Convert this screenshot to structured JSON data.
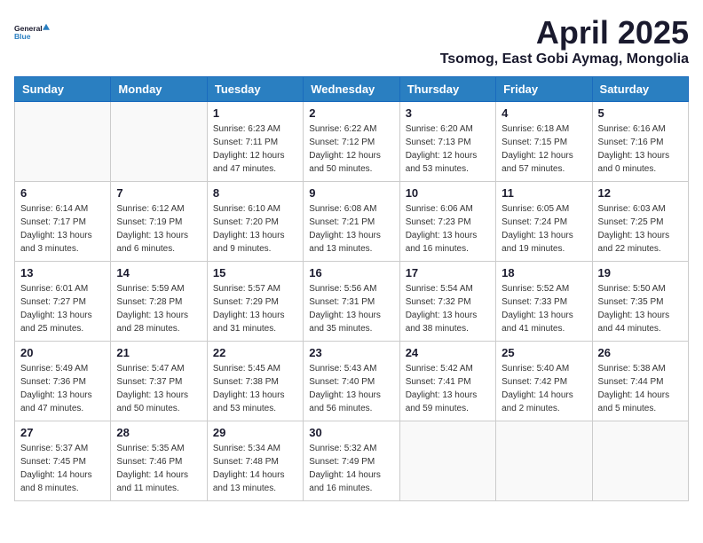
{
  "logo": {
    "text_general": "General",
    "text_blue": "Blue"
  },
  "title": "April 2025",
  "location": "Tsomog, East Gobi Aymag, Mongolia",
  "weekdays": [
    "Sunday",
    "Monday",
    "Tuesday",
    "Wednesday",
    "Thursday",
    "Friday",
    "Saturday"
  ],
  "weeks": [
    [
      {
        "day": null
      },
      {
        "day": null
      },
      {
        "day": "1",
        "sunrise": "6:23 AM",
        "sunset": "7:11 PM",
        "daylight": "12 hours and 47 minutes."
      },
      {
        "day": "2",
        "sunrise": "6:22 AM",
        "sunset": "7:12 PM",
        "daylight": "12 hours and 50 minutes."
      },
      {
        "day": "3",
        "sunrise": "6:20 AM",
        "sunset": "7:13 PM",
        "daylight": "12 hours and 53 minutes."
      },
      {
        "day": "4",
        "sunrise": "6:18 AM",
        "sunset": "7:15 PM",
        "daylight": "12 hours and 57 minutes."
      },
      {
        "day": "5",
        "sunrise": "6:16 AM",
        "sunset": "7:16 PM",
        "daylight": "13 hours and 0 minutes."
      }
    ],
    [
      {
        "day": "6",
        "sunrise": "6:14 AM",
        "sunset": "7:17 PM",
        "daylight": "13 hours and 3 minutes."
      },
      {
        "day": "7",
        "sunrise": "6:12 AM",
        "sunset": "7:19 PM",
        "daylight": "13 hours and 6 minutes."
      },
      {
        "day": "8",
        "sunrise": "6:10 AM",
        "sunset": "7:20 PM",
        "daylight": "13 hours and 9 minutes."
      },
      {
        "day": "9",
        "sunrise": "6:08 AM",
        "sunset": "7:21 PM",
        "daylight": "13 hours and 13 minutes."
      },
      {
        "day": "10",
        "sunrise": "6:06 AM",
        "sunset": "7:23 PM",
        "daylight": "13 hours and 16 minutes."
      },
      {
        "day": "11",
        "sunrise": "6:05 AM",
        "sunset": "7:24 PM",
        "daylight": "13 hours and 19 minutes."
      },
      {
        "day": "12",
        "sunrise": "6:03 AM",
        "sunset": "7:25 PM",
        "daylight": "13 hours and 22 minutes."
      }
    ],
    [
      {
        "day": "13",
        "sunrise": "6:01 AM",
        "sunset": "7:27 PM",
        "daylight": "13 hours and 25 minutes."
      },
      {
        "day": "14",
        "sunrise": "5:59 AM",
        "sunset": "7:28 PM",
        "daylight": "13 hours and 28 minutes."
      },
      {
        "day": "15",
        "sunrise": "5:57 AM",
        "sunset": "7:29 PM",
        "daylight": "13 hours and 31 minutes."
      },
      {
        "day": "16",
        "sunrise": "5:56 AM",
        "sunset": "7:31 PM",
        "daylight": "13 hours and 35 minutes."
      },
      {
        "day": "17",
        "sunrise": "5:54 AM",
        "sunset": "7:32 PM",
        "daylight": "13 hours and 38 minutes."
      },
      {
        "day": "18",
        "sunrise": "5:52 AM",
        "sunset": "7:33 PM",
        "daylight": "13 hours and 41 minutes."
      },
      {
        "day": "19",
        "sunrise": "5:50 AM",
        "sunset": "7:35 PM",
        "daylight": "13 hours and 44 minutes."
      }
    ],
    [
      {
        "day": "20",
        "sunrise": "5:49 AM",
        "sunset": "7:36 PM",
        "daylight": "13 hours and 47 minutes."
      },
      {
        "day": "21",
        "sunrise": "5:47 AM",
        "sunset": "7:37 PM",
        "daylight": "13 hours and 50 minutes."
      },
      {
        "day": "22",
        "sunrise": "5:45 AM",
        "sunset": "7:38 PM",
        "daylight": "13 hours and 53 minutes."
      },
      {
        "day": "23",
        "sunrise": "5:43 AM",
        "sunset": "7:40 PM",
        "daylight": "13 hours and 56 minutes."
      },
      {
        "day": "24",
        "sunrise": "5:42 AM",
        "sunset": "7:41 PM",
        "daylight": "13 hours and 59 minutes."
      },
      {
        "day": "25",
        "sunrise": "5:40 AM",
        "sunset": "7:42 PM",
        "daylight": "14 hours and 2 minutes."
      },
      {
        "day": "26",
        "sunrise": "5:38 AM",
        "sunset": "7:44 PM",
        "daylight": "14 hours and 5 minutes."
      }
    ],
    [
      {
        "day": "27",
        "sunrise": "5:37 AM",
        "sunset": "7:45 PM",
        "daylight": "14 hours and 8 minutes."
      },
      {
        "day": "28",
        "sunrise": "5:35 AM",
        "sunset": "7:46 PM",
        "daylight": "14 hours and 11 minutes."
      },
      {
        "day": "29",
        "sunrise": "5:34 AM",
        "sunset": "7:48 PM",
        "daylight": "14 hours and 13 minutes."
      },
      {
        "day": "30",
        "sunrise": "5:32 AM",
        "sunset": "7:49 PM",
        "daylight": "14 hours and 16 minutes."
      },
      {
        "day": null
      },
      {
        "day": null
      },
      {
        "day": null
      }
    ]
  ],
  "labels": {
    "sunrise": "Sunrise:",
    "sunset": "Sunset:",
    "daylight": "Daylight:"
  }
}
